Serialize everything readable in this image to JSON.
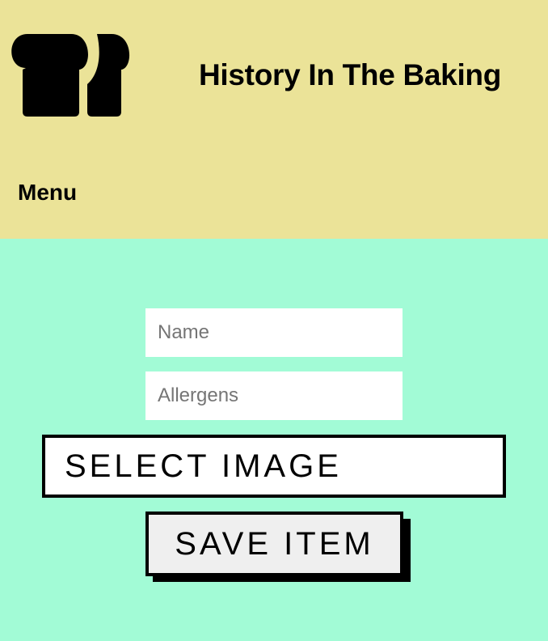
{
  "colors": {
    "header_background": "#ebe398",
    "page_background": "#a2fbd6",
    "accent": "#000000"
  },
  "header": {
    "logo_icon": "bread-loaves-icon",
    "title": "History In The Baking",
    "menu_label": "Menu"
  },
  "form": {
    "name_placeholder": "Name",
    "name_value": "",
    "allergens_placeholder": "Allergens",
    "allergens_value": "",
    "select_image_label": "SELECT IMAGE",
    "save_label": "SAVE ITEM"
  }
}
